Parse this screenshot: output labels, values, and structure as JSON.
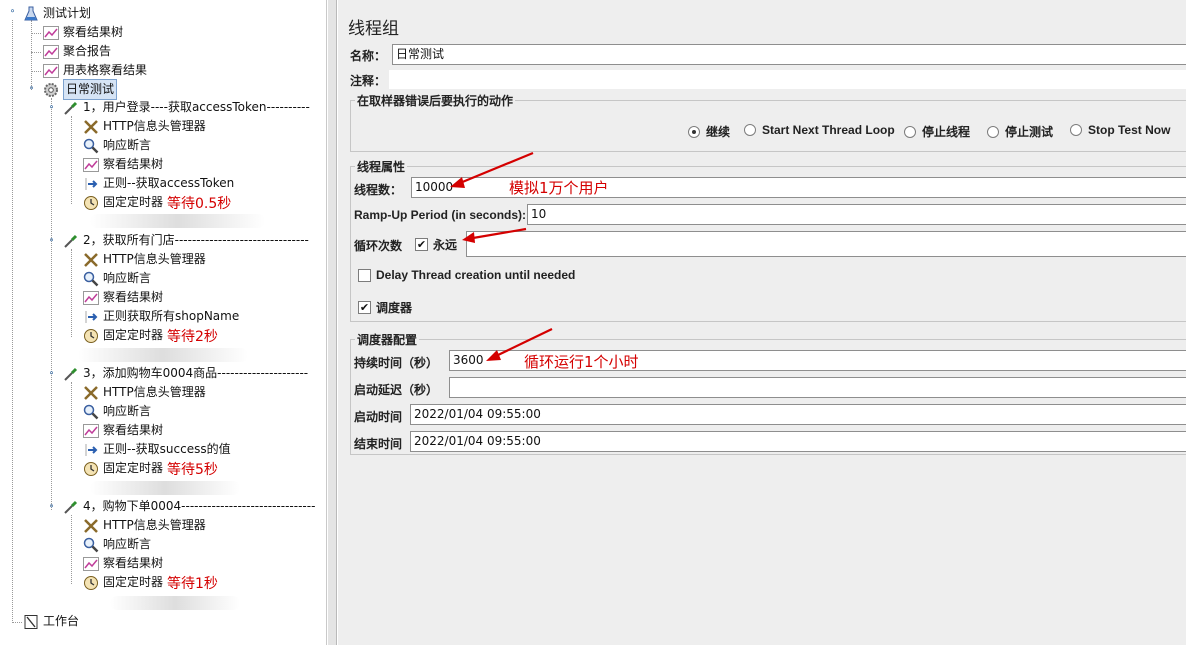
{
  "tree": {
    "root": "测试计划",
    "plan_items": [
      "察看结果树",
      "聚合报告",
      "用表格察看结果"
    ],
    "thread_group": "日常测试",
    "samplers": [
      {
        "label": "1，用户登录----获取accessToken----------",
        "children": [
          "HTTP信息头管理器",
          "响应断言",
          "察看结果树",
          "正则--获取accessToken",
          "固定定时器"
        ],
        "timer_note": "等待0.5秒"
      },
      {
        "label": "2，获取所有门店-------------------------------",
        "children": [
          "HTTP信息头管理器",
          "响应断言",
          "察看结果树",
          "正则获取所有shopName",
          "固定定时器"
        ],
        "timer_note": "等待2秒"
      },
      {
        "label": "3，添加购物车0004商品---------------------",
        "children": [
          "HTTP信息头管理器",
          "响应断言",
          "察看结果树",
          "正则--获取success的值",
          "固定定时器"
        ],
        "timer_note": "等待5秒"
      },
      {
        "label": "4，购物下单0004-------------------------------",
        "children": [
          "HTTP信息头管理器",
          "响应断言",
          "察看结果树",
          "固定定时器"
        ],
        "timer_note": "等待1秒"
      }
    ],
    "workbench": "工作台"
  },
  "panel": {
    "title": "线程组",
    "name_label": "名称：",
    "name_value": "日常测试",
    "comment_label": "注释：",
    "comment_value": "",
    "error_group_title": "在取样器错误后要执行的动作",
    "error_options": [
      "继续",
      "Start Next Thread Loop",
      "停止线程",
      "停止测试",
      "Stop Test Now"
    ],
    "error_selected": 0,
    "props_group_title": "线程属性",
    "threads_label": "线程数：",
    "threads_value": "10000",
    "rampup_label": "Ramp-Up Period (in seconds):",
    "rampup_value": "10",
    "loop_label": "循环次数",
    "loop_forever_label": "永远",
    "loop_forever_checked": true,
    "loop_value": "",
    "delay_label": "Delay Thread creation until needed",
    "delay_checked": false,
    "scheduler_label": "调度器",
    "scheduler_checked": true,
    "sched_group_title": "调度器配置",
    "duration_label": "持续时间（秒）",
    "duration_value": "3600",
    "delay_start_label": "启动延迟（秒）",
    "delay_start_value": "",
    "start_label": "启动时间",
    "start_value": "2022/01/04 09:55:00",
    "end_label": "结束时间",
    "end_value": "2022/01/04 09:55:00"
  },
  "annotations": {
    "threads_note": "模拟1万个用户",
    "duration_note": "循环运行1个小时",
    "color": "#d40000"
  },
  "icons": {
    "test_plan": "flask-icon",
    "listener": "graph-icon",
    "thread_group": "gear-icon",
    "sampler": "pipette-icon",
    "header_manager": "tools-icon",
    "assertion": "magnifier-icon",
    "extractor": "arrow-icon",
    "timer": "clock-icon",
    "workbench": "workbench-icon"
  }
}
